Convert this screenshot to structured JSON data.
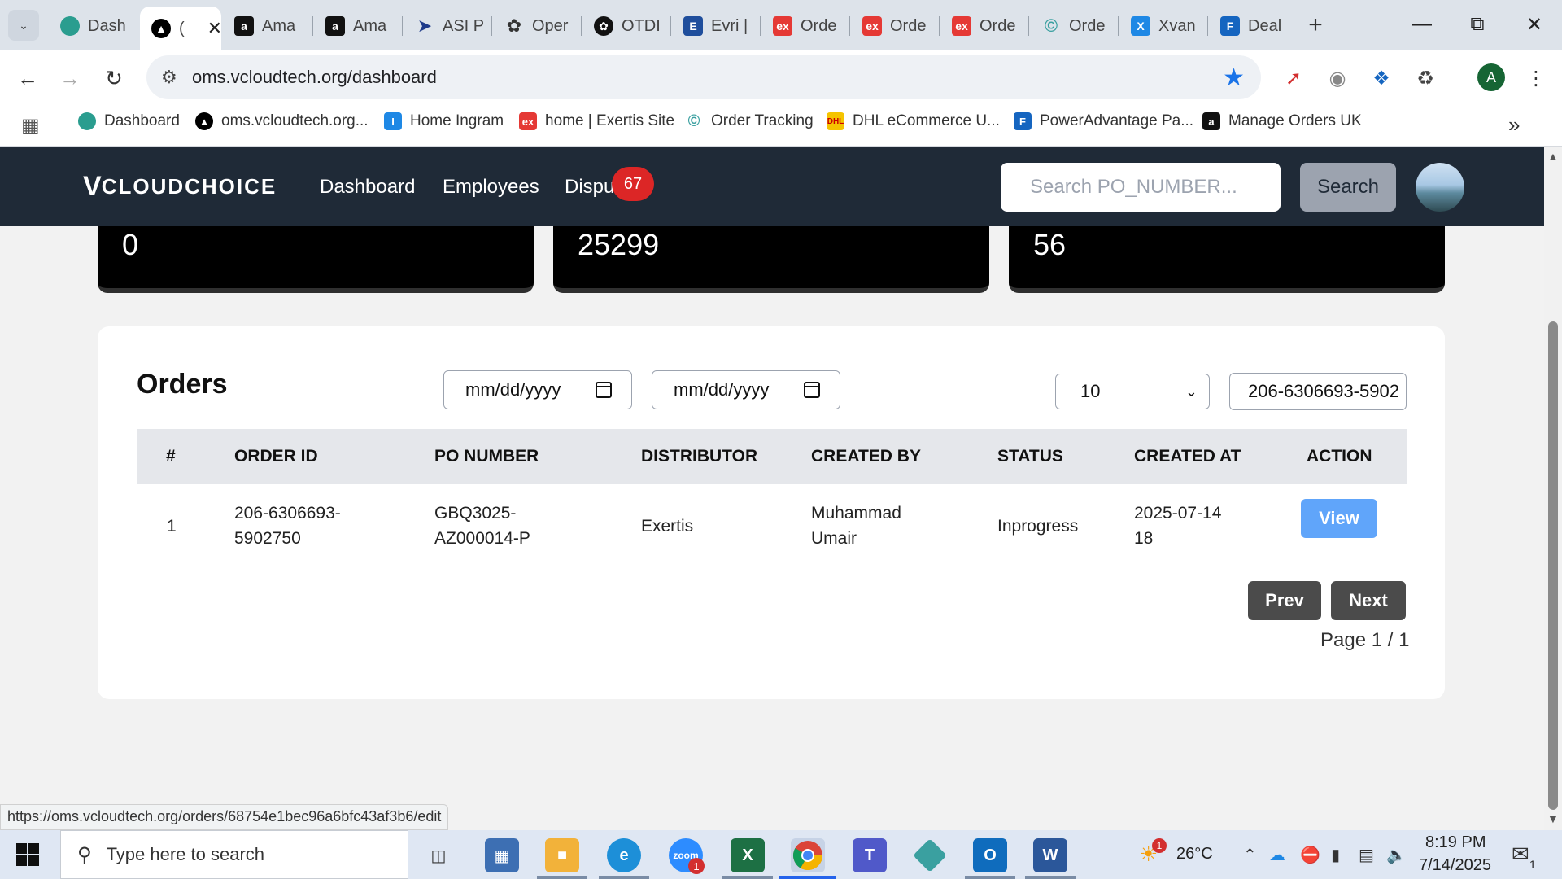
{
  "browser": {
    "tabs": [
      {
        "label": "Dash",
        "favicon": "hexagon-icon",
        "color": "#2a9d8f"
      },
      {
        "label": "(",
        "favicon": "vcloud-icon",
        "color": "#000000",
        "active": true
      },
      {
        "label": "Ama",
        "favicon": "amazon-icon",
        "color": "#111111"
      },
      {
        "label": "Ama",
        "favicon": "amazon-icon",
        "color": "#111111"
      },
      {
        "label": "ASI P",
        "favicon": "arrow-icon",
        "color": "#1e3a8a"
      },
      {
        "label": "Oper",
        "favicon": "openai-icon",
        "color": "#333333"
      },
      {
        "label": "OTDI",
        "favicon": "openai-icon",
        "color": "#111111"
      },
      {
        "label": "Evri |",
        "favicon": "evri-icon",
        "color": "#1f4e9c"
      },
      {
        "label": "Orde",
        "favicon": "exertis-icon",
        "color": "#e53935"
      },
      {
        "label": "Orde",
        "favicon": "exertis-icon",
        "color": "#e53935"
      },
      {
        "label": "Orde",
        "favicon": "exertis-icon",
        "color": "#e53935"
      },
      {
        "label": "Orde",
        "favicon": "tracking-icon",
        "color": "#3aa0a0"
      },
      {
        "label": "Xvan",
        "favicon": "xvan-icon",
        "color": "#1e88e5"
      },
      {
        "label": "Deal",
        "favicon": "deal-icon",
        "color": "#1565c0"
      }
    ],
    "url": "oms.vcloudtech.org/dashboard",
    "profile_initial": "A",
    "bookmarks": [
      {
        "label": "Dashboard",
        "favicon": "hexagon-icon",
        "color": "#2a9d8f"
      },
      {
        "label": "oms.vcloudtech.org...",
        "favicon": "vcloud-icon",
        "color": "#000000"
      },
      {
        "label": "Home Ingram",
        "favicon": "ingram-icon",
        "color": "#1e88e5"
      },
      {
        "label": "home | Exertis Site",
        "favicon": "exertis-icon",
        "color": "#e53935"
      },
      {
        "label": "Order Tracking",
        "favicon": "tracking-icon",
        "color": "#3aa0a0"
      },
      {
        "label": "DHL eCommerce U...",
        "favicon": "dhl-icon",
        "color": "#f5c400"
      },
      {
        "label": "PowerAdvantage Pa...",
        "favicon": "poweradvantage-icon",
        "color": "#1565c0"
      },
      {
        "label": "Manage Orders UK",
        "favicon": "amazon-icon",
        "color": "#111111"
      }
    ]
  },
  "app": {
    "logo_v": "V",
    "logo_text": "CLOUDCHOICE",
    "nav": {
      "dashboard": "Dashboard",
      "employees": "Employees",
      "disputes": "Dispu"
    },
    "disputes_badge": "67",
    "search_placeholder": "Search PO_NUMBER...",
    "search_button": "Search"
  },
  "stats": [
    "0",
    "25299",
    "56"
  ],
  "orders": {
    "title": "Orders",
    "date_from_placeholder": "mm/dd/yyyy",
    "date_to_placeholder": "mm/dd/yyyy",
    "page_size": "10",
    "filter_value": "206-6306693-5902",
    "columns": [
      "#",
      "ORDER ID",
      "PO NUMBER",
      "DISTRIBUTOR",
      "CREATED BY",
      "STATUS",
      "CREATED AT",
      "ACTION"
    ],
    "rows": [
      {
        "num": "1",
        "order_id": "206-6306693-\n5902750",
        "po_number": "GBQ3025-\nAZ000014-P",
        "distributor": "Exertis",
        "created_by": "Muhammad\nUmair",
        "status": "Inprogress",
        "created_at": "2025-07-14\n18",
        "action": "View"
      }
    ],
    "prev": "Prev",
    "next": "Next",
    "page_info": "Page 1 / 1"
  },
  "status_bar_url": "https://oms.vcloudtech.org/orders/68754e1bec96a6bfc43af3b6/edit",
  "taskbar": {
    "search_placeholder": "Type here to search",
    "weather_temp": "26°C",
    "weather_badge": "1",
    "zoom_badge": "1",
    "time": "8:19 PM",
    "date": "7/14/2025",
    "notification_count": "1"
  }
}
